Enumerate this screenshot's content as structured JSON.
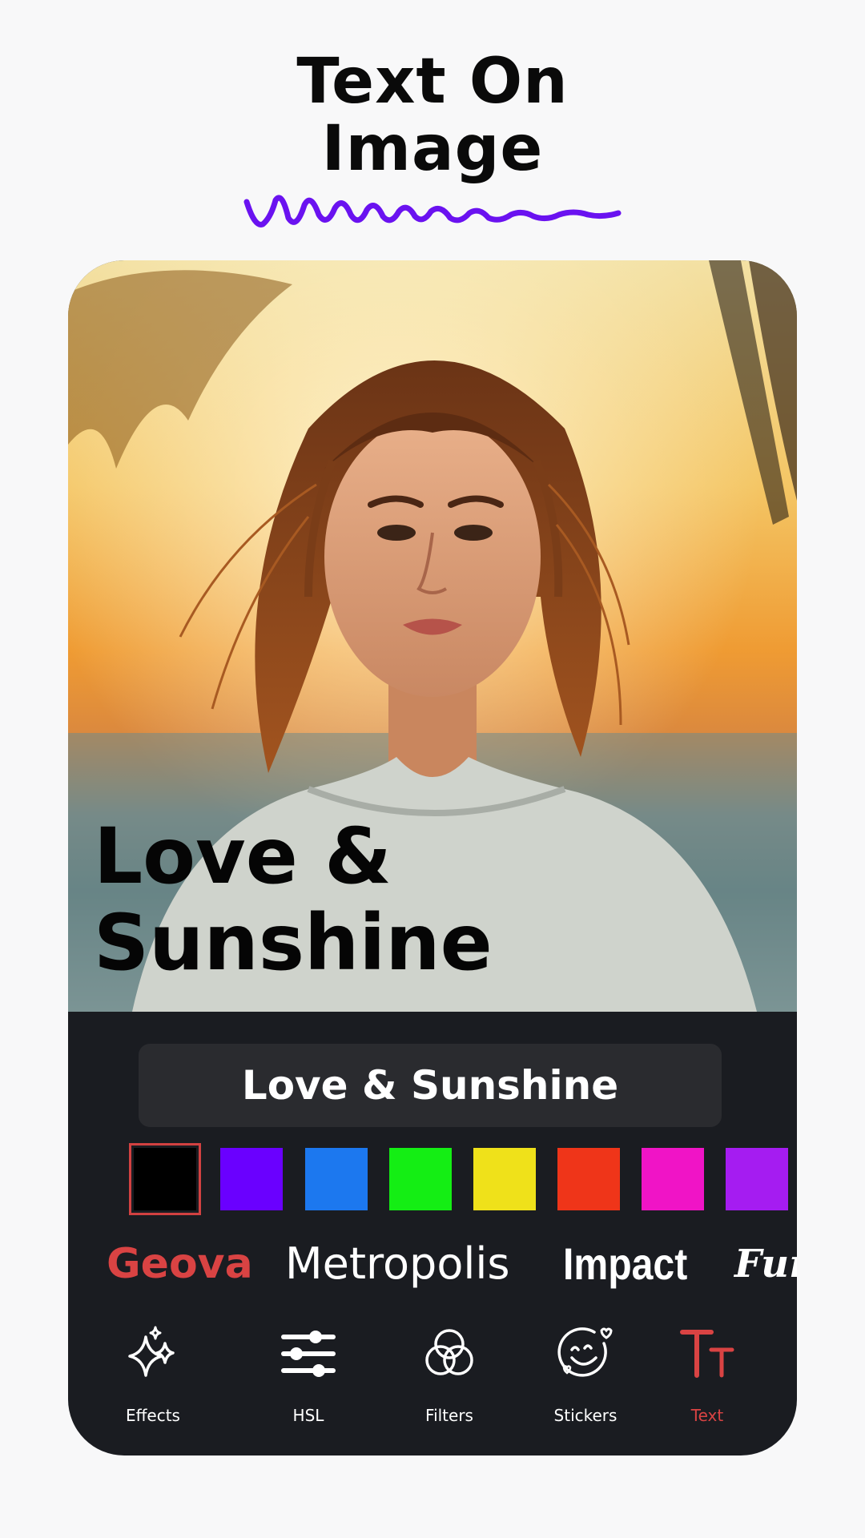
{
  "headline": {
    "line1": "Text On",
    "line2": "Image"
  },
  "preview": {
    "overlay_line1": "Love &",
    "overlay_line2": "Sunshine",
    "overlay_color": "#050505"
  },
  "editor": {
    "text_value": "Love & Sunshine",
    "colors": [
      {
        "name": "black",
        "hex": "#000000",
        "selected": true
      },
      {
        "name": "purple",
        "hex": "#6a00ff",
        "selected": false
      },
      {
        "name": "blue",
        "hex": "#1c78ef",
        "selected": false
      },
      {
        "name": "green",
        "hex": "#14ee14",
        "selected": false
      },
      {
        "name": "yellow",
        "hex": "#efe11a",
        "selected": false
      },
      {
        "name": "red-orange",
        "hex": "#ef3519",
        "selected": false
      },
      {
        "name": "magenta",
        "hex": "#f014c6",
        "selected": false
      },
      {
        "name": "violet",
        "hex": "#a51cf1",
        "selected": false
      }
    ],
    "fonts": [
      "Geova",
      "Metropolis",
      "Impact",
      "Funk"
    ],
    "selected_font": "Geova"
  },
  "bottom_nav": {
    "items": [
      {
        "label": "Effects",
        "icon": "sparkles-icon",
        "active": false
      },
      {
        "label": "HSL",
        "icon": "sliders-icon",
        "active": false
      },
      {
        "label": "Filters",
        "icon": "filters-icon",
        "active": false
      },
      {
        "label": "Stickers",
        "icon": "sticker-face-icon",
        "active": false
      },
      {
        "label": "Text",
        "icon": "text-size-icon",
        "active": true
      }
    ]
  },
  "accent_color": "#d94343",
  "squiggle_color": "#6a12f0"
}
